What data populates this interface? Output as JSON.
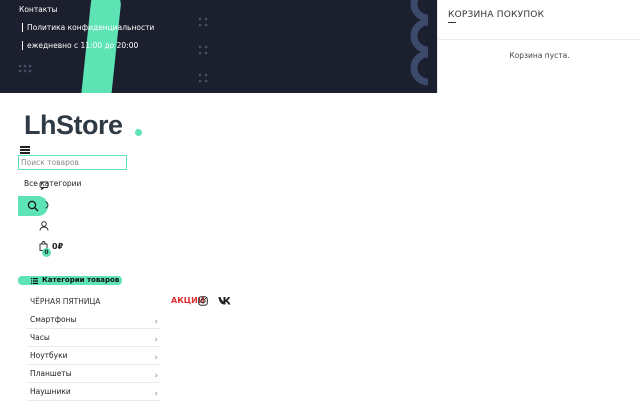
{
  "top_bar": {
    "links": [
      "Контакты",
      "Политика конфиденциальности",
      "ежедневно с 11:00 до 20:00"
    ]
  },
  "cart_panel": {
    "title": "КОРЗИНА ПОКУПОК",
    "empty_text": "Корзина пуста."
  },
  "header": {
    "logo_text": "LhStore",
    "search_placeholder": "Поиск товаров",
    "category_select": "Все категории",
    "cart_total": "0₽",
    "cart_count": "0"
  },
  "categories": {
    "title": "Категории товаров",
    "items": [
      "ЧЁРНАЯ ПЯТНИЦА",
      "Смартфоны",
      "Часы",
      "Ноутбуки",
      "Планшеты",
      "Наушники"
    ]
  },
  "promo": {
    "label": "АКЦИИ"
  },
  "colors": {
    "accent": "#5ee3b4",
    "dark": "#1c1f2e",
    "promo": "#e03131"
  }
}
